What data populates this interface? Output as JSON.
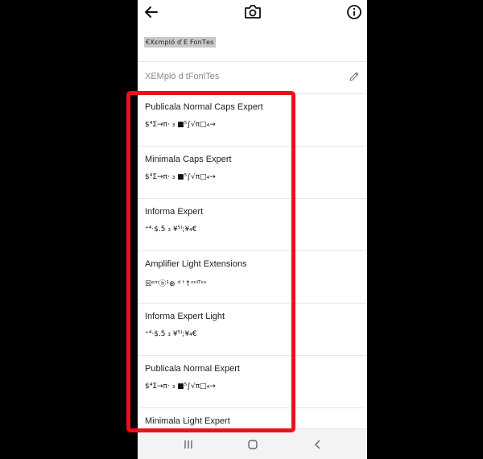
{
  "preview": {
    "text": "€Χεmpló ď E FonΤes"
  },
  "edit_field": {
    "text": "XEMpló d tFonlTes"
  },
  "fonts": [
    {
      "name": "Publicala Normal Caps Expert",
      "sample": "$⁴Σ→π· ₃ ■⁵∫√π□₄→"
    },
    {
      "name": "Minimala Caps Expert",
      "sample": "$⁴Σ→π· ₃ ■⁵∫√π□₄→"
    },
    {
      "name": "Informa Expert",
      "sample": "⁺⁴·$.5 ₃ ¥⁵⁾;¥₄€"
    },
    {
      "name": "Amplifier Light Extensions",
      "sample": "☒ᵉᵐⓑ¹⊕ ᵈ ᵗ↑ᵒⁿˡᵀᵉˢ"
    },
    {
      "name": "Informa Expert Light",
      "sample": "⁺⁴·$.5 ₃ ¥⁵⁾;¥₄€"
    },
    {
      "name": "Publicala Normal Expert",
      "sample": "$⁴Σ→π· ₃ ■⁵∫√π□₄→"
    },
    {
      "name": "Minimala Light Expert",
      "sample": ""
    }
  ],
  "colors": {
    "highlight": "#e8121f",
    "background": "#000000"
  },
  "icons": {
    "back": "arrow-left-icon",
    "camera": "camera-icon",
    "info": "info-icon",
    "edit": "pencil-icon",
    "nav_recent": "recent-apps-icon",
    "nav_home": "home-icon",
    "nav_back": "chevron-left-icon"
  }
}
